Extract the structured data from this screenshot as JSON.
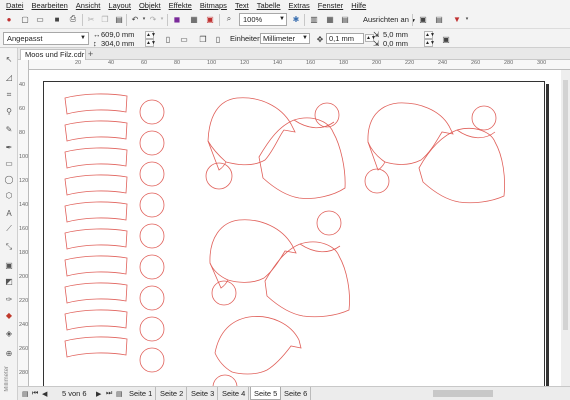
{
  "menu": [
    "Datei",
    "Bearbeiten",
    "Ansicht",
    "Layout",
    "Objekt",
    "Effekte",
    "Bitmaps",
    "Text",
    "Tabelle",
    "Extras",
    "Fenster",
    "Hilfe"
  ],
  "toolbar": {
    "zoom": "100%",
    "align_label": "Ausrichten an"
  },
  "propertybar": {
    "preset": "Angepasst",
    "width": "609,0 mm",
    "height": "304,0 mm",
    "units_label": "Einheiten:",
    "units": "Millimeter",
    "nudge": "0,1 mm",
    "dup_x": "5,0 mm",
    "dup_y": "0,0 mm"
  },
  "document": {
    "tab_name": "Moos und Filz.cdr",
    "add_tab": "+"
  },
  "ruler": {
    "h": [
      "20",
      "40",
      "60",
      "80",
      "100",
      "120",
      "140",
      "160",
      "180",
      "200",
      "220",
      "240",
      "260",
      "280",
      "300",
      "320"
    ],
    "v": [
      "40",
      "60",
      "80",
      "100",
      "120",
      "140",
      "160",
      "180",
      "200",
      "220",
      "240",
      "260",
      "280"
    ]
  },
  "sidebar_label": "Millimeter",
  "pages": {
    "current": "5 von 6",
    "tabs": [
      "Seite 1",
      "Seite 2",
      "Seite 3",
      "Seite 4",
      "Seite 5",
      "Seite 6"
    ],
    "active": "Seite 5"
  },
  "colors": {
    "outline": "#e0605a",
    "page_border": "#333333"
  },
  "icons": {
    "menu": "corel-menu-icon",
    "new": "new-file-icon",
    "open": "open-folder-icon",
    "save": "save-icon",
    "print": "print-icon",
    "cut": "cut-icon",
    "copy": "copy-icon",
    "paste": "paste-icon",
    "undo": "undo-icon",
    "redo": "redo-icon",
    "import": "import-icon",
    "export": "export-icon",
    "publish": "publish-pdf-icon",
    "full_screen": "full-screen-icon",
    "rulers": "rulers-icon",
    "grid": "grid-icon",
    "guides": "guides-icon",
    "options": "options-icon",
    "launch": "app-launcher-icon",
    "portrait": "portrait-icon",
    "landscape": "landscape-icon",
    "all_pages": "all-pages-icon",
    "current_page": "current-page-icon",
    "nudge": "nudge-icon",
    "pointer": "pointer-tool-icon",
    "shape": "shape-tool-icon",
    "crop": "crop-tool-icon",
    "zoom": "zoom-tool-icon",
    "freehand": "freehand-tool-icon",
    "artistic_media": "artistic-media-icon",
    "rectangle": "rectangle-tool-icon",
    "ellipse": "ellipse-tool-icon",
    "polygon": "polygon-tool-icon",
    "text": "text-tool-icon",
    "parallel": "parallel-dimension-icon",
    "connector": "connector-tool-icon",
    "shadow": "drop-shadow-icon",
    "transparency": "transparency-icon",
    "eyedropper": "eyedropper-icon",
    "interactive_fill": "interactive-fill-icon",
    "smart_fill": "smart-fill-icon",
    "add_tool": "add-tool-icon"
  }
}
